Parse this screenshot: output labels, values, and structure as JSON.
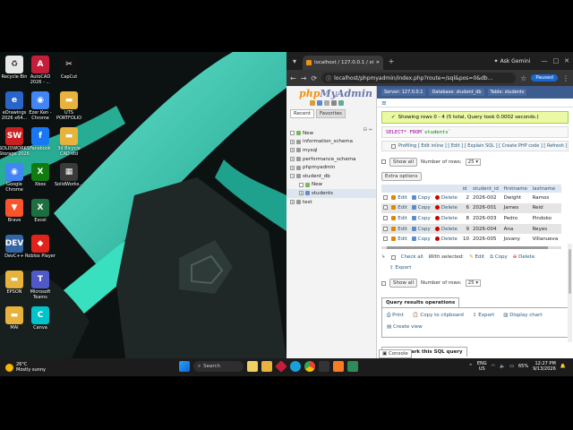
{
  "desktop": {
    "icons": [
      {
        "label": "Recycle Bin",
        "color": "#e8e8e8",
        "glyph": "♻",
        "icon": "recycle-bin-icon"
      },
      {
        "label": "AutoCAD 2026 - ...",
        "color": "#c41e3a",
        "glyph": "A",
        "icon": "autocad-icon"
      },
      {
        "label": "CapCut",
        "color": "#111111",
        "glyph": "✂",
        "icon": "capcut-icon"
      },
      {
        "label": "eDrawings 2026 x64...",
        "color": "#2b64c8",
        "glyph": "e",
        "icon": "edrawings-icon"
      },
      {
        "label": "Ezer Ken - Chrome",
        "color": "#4285f4",
        "glyph": "◉",
        "icon": "chrome-icon"
      },
      {
        "label": "UTS PORTFOLIO",
        "color": "#e8b33c",
        "glyph": "▬",
        "icon": "folder-icon"
      },
      {
        "label": "SOLIDWORKS Storage 2026",
        "color": "#cc2020",
        "glyph": "SW",
        "icon": "solidworks-icon"
      },
      {
        "label": "Facebook",
        "color": "#1877f2",
        "glyph": "f",
        "icon": "facebook-icon"
      },
      {
        "label": "3d Bicycle CAD std",
        "color": "#e8b33c",
        "glyph": "▬",
        "icon": "folder-icon"
      },
      {
        "label": "Google Chrome",
        "color": "#4285f4",
        "glyph": "◉",
        "icon": "chrome-icon"
      },
      {
        "label": "Xbox",
        "color": "#107c10",
        "glyph": "X",
        "icon": "xbox-icon"
      },
      {
        "label": "SolidWorks...",
        "color": "#3a3a3a",
        "glyph": "▦",
        "icon": "solidworks-file-icon"
      },
      {
        "label": "Brave",
        "color": "#fb542b",
        "glyph": "▼",
        "icon": "brave-icon"
      },
      {
        "label": "Excel",
        "color": "#1d6f42",
        "glyph": "X",
        "icon": "excel-icon"
      },
      {
        "label": "DevC++",
        "color": "#3465a4",
        "glyph": "DEV",
        "icon": "devcpp-icon"
      },
      {
        "label": "Roblox Player",
        "color": "#e2231a",
        "glyph": "◆",
        "icon": "roblox-icon"
      },
      {
        "label": "EPSON",
        "color": "#e8b33c",
        "glyph": "▬",
        "icon": "folder-icon"
      },
      {
        "label": "Microsoft Teams",
        "color": "#5059c9",
        "glyph": "T",
        "icon": "teams-icon"
      },
      {
        "label": "MAI",
        "color": "#e8b33c",
        "glyph": "▬",
        "icon": "folder-icon"
      },
      {
        "label": "Canva",
        "color": "#00c4cc",
        "glyph": "C",
        "icon": "canva-icon"
      }
    ]
  },
  "browser": {
    "tab_title": "localhost / 127.0.0.1 / student...",
    "ask_gemini": "Ask Gemini",
    "url": "localhost/phpmyadmin/index.php?route=/sql&pos=0&db...",
    "paused": "Paused",
    "new_tab": "+",
    "min": "—",
    "max": "□",
    "close": "✕",
    "back": "←",
    "forward": "→",
    "reload": "⟳"
  },
  "pma": {
    "logo_php": "php",
    "logo_myadmin": "MyAdmin",
    "nav_tabs": [
      "Recent",
      "Favorites"
    ],
    "tree": [
      {
        "label": "New",
        "level": 0,
        "icon": "new"
      },
      {
        "label": "information_schema",
        "level": 0,
        "icon": "db"
      },
      {
        "label": "mysql",
        "level": 0,
        "icon": "db"
      },
      {
        "label": "performance_schema",
        "level": 0,
        "icon": "db"
      },
      {
        "label": "phpmyadmin",
        "level": 0,
        "icon": "db"
      },
      {
        "label": "student_db",
        "level": 0,
        "icon": "db"
      },
      {
        "label": "New",
        "level": 1,
        "icon": "new"
      },
      {
        "label": "students",
        "level": 1,
        "icon": "table"
      },
      {
        "label": "test",
        "level": 0,
        "icon": "db"
      }
    ],
    "breadcrumb": [
      "Server: 127.0.0.1",
      "Database: student_db",
      "Table: students"
    ],
    "success_msg": "Showing rows 0 - 4 (5 total, Query took 0.0002 seconds.)",
    "sql_select": "SELECT",
    "sql_rest": " * FROM ",
    "sql_table": "`students`",
    "profiling": "Profiling [ Edit inline ] [ Edit ] [ Explain SQL ] [ Create PHP code ] [ Refresh ]",
    "show_all": "Show all",
    "rows_label": "Number of rows:",
    "rows_value": "25",
    "extra_options": "Extra options",
    "columns": [
      "",
      "",
      "",
      "",
      "id",
      "student_id",
      "firstname",
      "lastname"
    ],
    "row_actions": {
      "edit": "Edit",
      "copy": "Copy",
      "delete": "Delete"
    },
    "rows": [
      {
        "id": "2",
        "student_id": "2026-002",
        "firstname": "Dwight",
        "lastname": "Ramos"
      },
      {
        "id": "6",
        "student_id": "2026-001",
        "firstname": "James",
        "lastname": "Reid"
      },
      {
        "id": "8",
        "student_id": "2026-003",
        "firstname": "Pedro",
        "lastname": "Pindoko"
      },
      {
        "id": "9",
        "student_id": "2026-004",
        "firstname": "Ana",
        "lastname": "Reyes"
      },
      {
        "id": "10",
        "student_id": "2026-005",
        "firstname": "Jovany",
        "lastname": "Villanueva"
      }
    ],
    "check_all": "Check all",
    "with_selected": "With selected:",
    "ws_edit": "Edit",
    "ws_copy": "Copy",
    "ws_delete": "Delete",
    "ws_export": "Export",
    "qro_title": "Query results operations",
    "qro_items": [
      "Print",
      "Copy to clipboard",
      "Export",
      "Display chart",
      "Create view"
    ],
    "bookmark": "Bookmark this SQL query",
    "console": "Console"
  },
  "taskbar": {
    "temp": "26°C",
    "weather": "Mostly sunny",
    "search": "Search",
    "lang1": "ENG",
    "lang2": "US",
    "battery": "65%",
    "time": "12:27 PM",
    "date": "9/13/2026"
  }
}
